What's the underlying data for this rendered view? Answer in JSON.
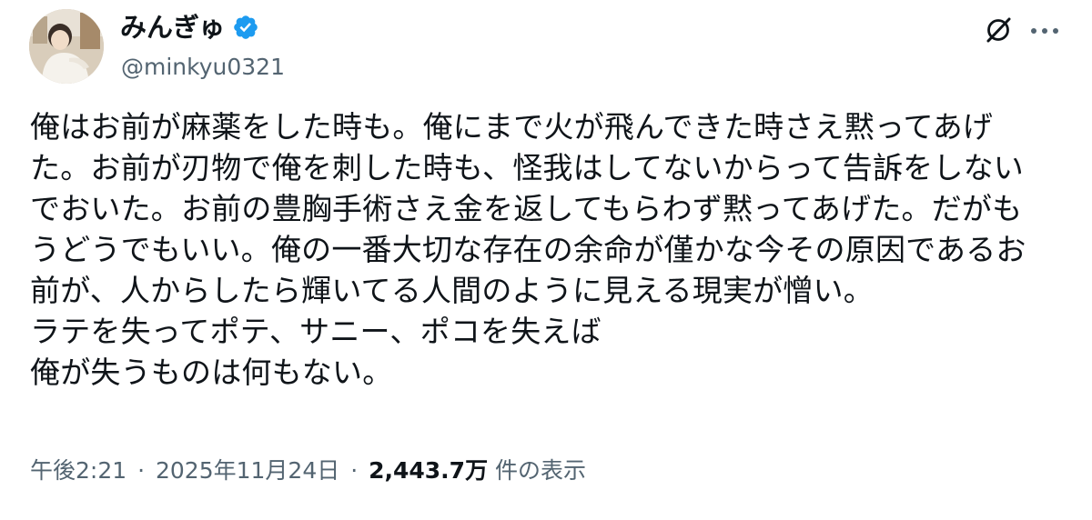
{
  "author": {
    "display_name": "みんぎゅ",
    "handle": "@minkyu0321",
    "verified_icon": "verified-badge-icon",
    "verified_color": "#1d9bf0"
  },
  "header_actions": {
    "grok_icon": "grok-icon",
    "more_icon": "more-horizontal-icon"
  },
  "post": {
    "lines": [
      "俺はお前が麻薬をした時も。俺にまで火が飛んできた時さえ黙ってあげ",
      "た。お前が刃物で俺を刺した時も、怪我はしてないからって告訴をしない",
      "でおいた。お前の豊胸手術さえ金を返してもらわず黙ってあげた。だがも",
      "うどうでもいい。俺の一番大切な存在の余命が僅かな今その原因であるお",
      "前が、人からしたら輝いてる人間のように見える現実が憎い。",
      "ラテを失ってポテ、サニー、ポコを失えば",
      "俺が失うものは何もない。"
    ]
  },
  "meta": {
    "time": "午後2:21",
    "separator": "·",
    "date": "2025年11月24日",
    "views_count": "2,443.7万",
    "views_label": "件の表示"
  },
  "colors": {
    "text": "#0f1419",
    "secondary": "#536471",
    "accent": "#1d9bf0"
  }
}
